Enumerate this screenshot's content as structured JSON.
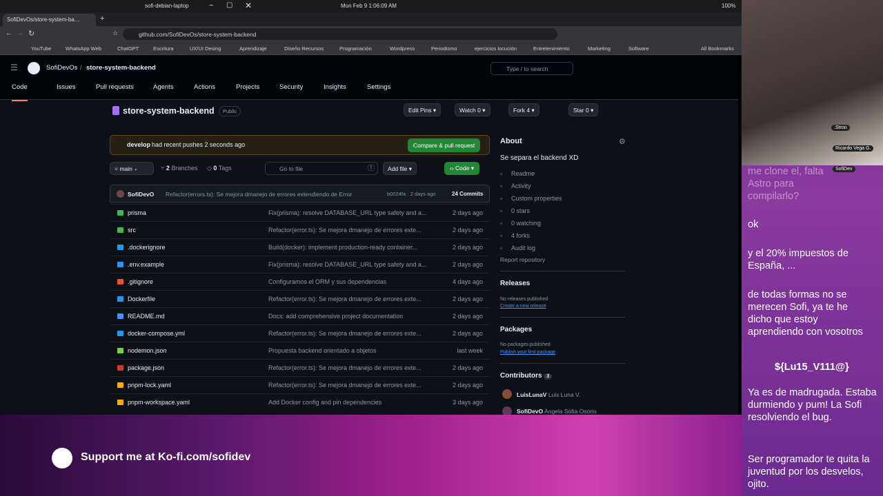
{
  "os": {
    "window_title": "sofi-debian-laptop",
    "datetime": "Mon Feb 9   1:06:09 AM",
    "battery": "100%"
  },
  "browser": {
    "tab_title": "SofiDevOs/store-system-ba…",
    "url": "github.com/SofiDevOs/store-system-backend",
    "bookmarks": [
      "YouTube",
      "WhatsApp Web",
      "ChatGPT",
      "Escritura",
      "UX/UI Desing",
      "Aprendizaje",
      "Diseño Recursos",
      "Programación",
      "Wordpress",
      "Periodismo",
      "ejercicios locución",
      "Entretenimiento",
      "Marketing",
      "Software"
    ],
    "all_bookmarks": "All Bookmarks"
  },
  "github": {
    "owner": "SofiDevOs",
    "repo": "store-system-backend",
    "search": "Type / to search",
    "nav": [
      "Code",
      "Issues",
      "Pull requests",
      "Agents",
      "Actions",
      "Projects",
      "Security",
      "Insights",
      "Settings"
    ],
    "visibility": "Public",
    "edit_pins": "Edit Pins",
    "watch": "Watch",
    "watch_count": "0",
    "fork": "Fork",
    "fork_count": "4",
    "star": "Star",
    "star_count": "0",
    "push_branch": "develop",
    "push_text": "had recent pushes 2 seconds ago",
    "compare_btn": "Compare & pull request",
    "branch": "main",
    "branches_count": "2",
    "branches_label": "Branches",
    "tags_count": "0",
    "tags_label": "Tags",
    "goto_placeholder": "Go to file",
    "goto_key": "t",
    "add_file": "Add file",
    "code_btn": "Code",
    "commit_author": "SofiDevO",
    "commit_msg": "Refactor(errors.ts): Se mejora dmanejo de errores extendiendo de Error",
    "commit_hash": "b0024fa · 2 days ago",
    "commit_count": "24 Commits",
    "files": [
      {
        "name": "prisma",
        "msg": "Fix(prisma): resolve DATABASE_URL type safety and a...",
        "date": "2 days ago",
        "color": "#3fb950"
      },
      {
        "name": "src",
        "msg": "Refactor(error.ts): Se mejora dmanejo de errores exte...",
        "date": "2 days ago",
        "color": "#3fb950"
      },
      {
        "name": ".dockerignore",
        "msg": "Build(docker): implement production-ready container...",
        "date": "2 days ago",
        "color": "#2496ed"
      },
      {
        "name": ".env.example",
        "msg": "Fix(prisma): resolve DATABASE_URL type safety and a...",
        "date": "2 days ago",
        "color": "#2496ed"
      },
      {
        "name": ".gitignore",
        "msg": "Configuramos el ORM y sus dependencias",
        "date": "4 days ago",
        "color": "#f05032"
      },
      {
        "name": "Dockerfile",
        "msg": "Refactor(error.ts): Se mejora dmanejo de errores exte...",
        "date": "2 days ago",
        "color": "#2496ed"
      },
      {
        "name": "README.md",
        "msg": "Docs: add comprehensive project documentation",
        "date": "2 days ago",
        "color": "#4493f8"
      },
      {
        "name": "docker-compose.yml",
        "msg": "Refactor(error.ts): Se mejora dmanejo de errores exte...",
        "date": "2 days ago",
        "color": "#2496ed"
      },
      {
        "name": "nodemon.json",
        "msg": "Propuesta backend orientado a objetos",
        "date": "last week",
        "color": "#76d04b"
      },
      {
        "name": "package.json",
        "msg": "Refactor(error.ts): Se mejora dmanejo de errores exte...",
        "date": "2 days ago",
        "color": "#cb3837"
      },
      {
        "name": "pnpm-lock.yaml",
        "msg": "Refactor(error.ts): Se mejora dmanejo de errores exte...",
        "date": "2 days ago",
        "color": "#f9ad00"
      },
      {
        "name": "pnpm-workspace.yaml",
        "msg": "Add Docker config and pin dependencies",
        "date": "3 days ago",
        "color": "#f9ad00"
      }
    ],
    "about_title": "About",
    "about_desc": "Se separa el backend XD",
    "about_items": [
      "Readme",
      "Activity",
      "Custom properties",
      "0 stars",
      "0 watching",
      "4 forks",
      "Audit log"
    ],
    "report": "Report repository",
    "releases_title": "Releases",
    "releases_none": "No releases published",
    "releases_link": "Create a new release",
    "packages_title": "Packages",
    "packages_none": "No packages published",
    "packages_link": "Publish your first package",
    "contributors_title": "Contributors",
    "contributors_count": "3",
    "contributors": [
      {
        "user": "LuisLunaV",
        "name": "Luis Luna V."
      },
      {
        "user": "SofiDevO",
        "name": "Angela Sofia Osorio"
      }
    ]
  },
  "stream": {
    "kofi": "Support me at Ko-fi.com/sofidev",
    "labels": [
      ".Stron",
      "Ricardo Vega G.",
      "SofiDev"
    ],
    "chat": [
      "me clone el, falta Astro para compilarlo?",
      "ok",
      "y el 20% impuestos de España, ...",
      "de todas formas no se merecen Sofi, ya te he dicho que estoy aprendiendo con vosotros",
      "${Lu15_V111@}",
      "Ya es de madrugada. Estaba durmiendo y pum! La Sofi resolviendo el bug.",
      "Ser programador te quita la juventud por los desvelos, ojito."
    ]
  }
}
